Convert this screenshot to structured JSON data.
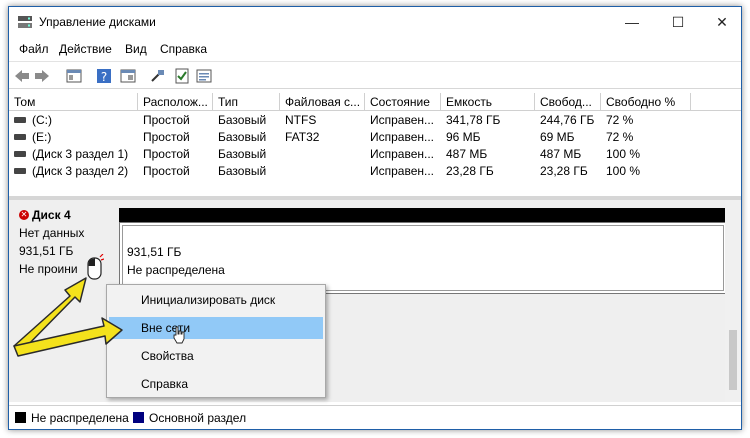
{
  "window": {
    "title": "Управление дисками",
    "minimize": "—",
    "maximize": "☐",
    "close": "✕"
  },
  "menu": [
    "Файл",
    "Действие",
    "Вид",
    "Справка"
  ],
  "volumes": {
    "columns": [
      "Том",
      "Располож...",
      "Тип",
      "Файловая с...",
      "Состояние",
      "Емкость",
      "Свобод...",
      "Свободно %"
    ],
    "rows": [
      [
        "(C:)",
        "Простой",
        "Базовый",
        "NTFS",
        "Исправен...",
        "341,78 ГБ",
        "244,76 ГБ",
        "72 %"
      ],
      [
        "(E:)",
        "Простой",
        "Базовый",
        "FAT32",
        "Исправен...",
        "96 МБ",
        "69 МБ",
        "72 %"
      ],
      [
        "(Диск 3 раздел 1)",
        "Простой",
        "Базовый",
        "",
        "Исправен...",
        "487 МБ",
        "487 МБ",
        "100 %"
      ],
      [
        "(Диск 3 раздел 2)",
        "Простой",
        "Базовый",
        "",
        "Исправен...",
        "23,28 ГБ",
        "23,28 ГБ",
        "100 %"
      ]
    ]
  },
  "disk": {
    "name": "Диск 4",
    "state": "Нет данных",
    "size": "931,51 ГБ",
    "init": "Не проини",
    "partition_size": "931,51 ГБ",
    "partition_status": "Не распределена"
  },
  "context_menu": {
    "items": [
      "Инициализировать диск",
      "Вне сети",
      "Свойства",
      "Справка"
    ],
    "highlighted": 1
  },
  "legend": {
    "unallocated": "Не распределена",
    "primary": "Основной раздел",
    "unallocated_color": "#000000",
    "primary_color": "#00007f"
  },
  "colors": {
    "highlight": "#91c9f7",
    "arrow": "#f4e21c"
  }
}
